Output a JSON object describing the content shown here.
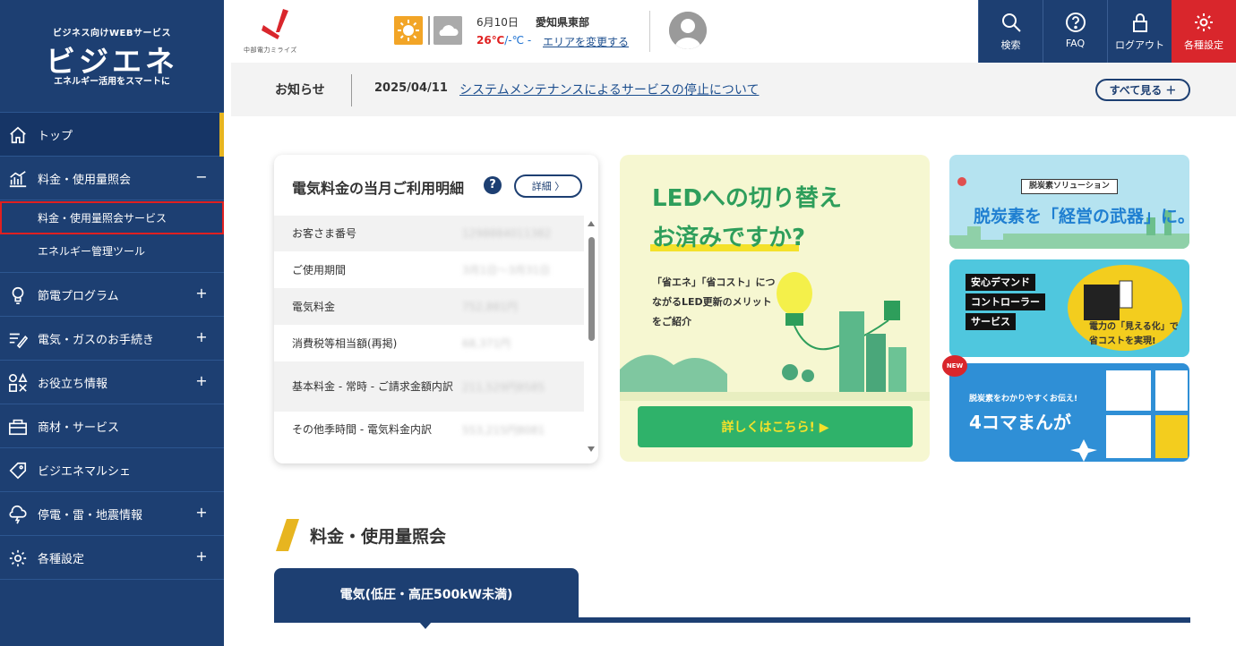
{
  "brand": {
    "tagline": "ビジネス向けWEBサービス",
    "name": "ビジエネ",
    "subtitle": "エネルギー活用をスマートに"
  },
  "sidebar": {
    "items": [
      {
        "label": "トップ",
        "icon": "home-icon",
        "toggle": ""
      },
      {
        "label": "料金・使用量照会",
        "icon": "chart-icon",
        "toggle": "−"
      },
      {
        "label": "節電プログラム",
        "icon": "bulb-icon",
        "toggle": "+"
      },
      {
        "label": "電気・ガスのお手続き",
        "icon": "form-icon",
        "toggle": "+"
      },
      {
        "label": "お役立ち情報",
        "icon": "shapes-icon",
        "toggle": "+"
      },
      {
        "label": "商材・サービス",
        "icon": "box-icon",
        "toggle": ""
      },
      {
        "label": "ビジエネマルシェ",
        "icon": "tag-icon",
        "toggle": ""
      },
      {
        "label": "停電・雷・地震情報",
        "icon": "storm-icon",
        "toggle": "+"
      },
      {
        "label": "各種設定",
        "icon": "gear-icon",
        "toggle": "+"
      }
    ],
    "subitems": [
      {
        "label": "料金・使用量照会サービス"
      },
      {
        "label": "エネルギー管理ツール"
      }
    ]
  },
  "header": {
    "logo_text": "中部電力ミライズ",
    "weather": {
      "date": "6月10日",
      "area": "愛知県東部",
      "high": "26℃",
      "low": "/-℃ -",
      "change_link": "エリアを変更する"
    },
    "tools": [
      {
        "label": "検索",
        "icon": "search-icon"
      },
      {
        "label": "FAQ",
        "icon": "faq-icon"
      },
      {
        "label": "ログアウト",
        "icon": "lock-icon"
      },
      {
        "label": "各種設定",
        "icon": "gear-icon"
      }
    ]
  },
  "notice": {
    "label": "お知らせ",
    "date": "2025/04/11",
    "text": "システムメンテナンスによるサービスの停止について",
    "all_button": "すべて見る ＋"
  },
  "billing_card": {
    "title": "電気料金の当月ご利用明細",
    "help": "?",
    "detail_button": "詳細 〉",
    "rows": [
      {
        "label": "お客さま番号",
        "value": "1298884011382"
      },
      {
        "label": "ご使用期間",
        "value": "3月1日～3月31日"
      },
      {
        "label": "電気料金",
        "value": "752,881円"
      },
      {
        "label": "消費税等相当額(再掲)",
        "value": "68,371円"
      },
      {
        "label": "基本料金 - 常時 - ご請求金額内訳",
        "value": "211,529円8585"
      },
      {
        "label": "その他季時間 - 電気料金内訳",
        "value": "553,215円8081"
      }
    ]
  },
  "led_banner": {
    "heading_line1": "LEDへの切り替え",
    "heading_line2": "お済みですか?",
    "body": "「省エネ」「省コスト」につながるLED更新のメリットをご紹介",
    "button": "詳しくはこちら! ▶"
  },
  "side_banners": {
    "decarb_tag": "脱炭素ソリューション",
    "decarb_title": "脱炭素を「経営の武器」に。",
    "demand_lines": [
      "安心デマンド",
      "コントローラー",
      "サービス"
    ],
    "demand_caption": "電力の「見える化」で省コストを実現!",
    "new_badge": "NEW",
    "manga_sub": "脱炭素をわかりやすくお伝え!",
    "manga_title": "4コマまんが"
  },
  "section": {
    "title": "料金・使用量照会",
    "tab": "電気(低圧・高圧500kW未満)"
  },
  "colors": {
    "navy": "#1d3f72",
    "accent_yellow": "#e7b520",
    "red": "#d9262c",
    "green": "#2fb26a"
  }
}
